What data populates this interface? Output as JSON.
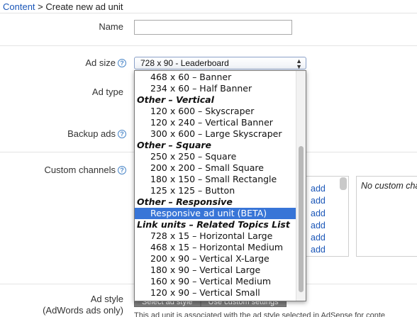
{
  "breadcrumb": {
    "link": "Content",
    "separator": " > ",
    "current": "Create new ad unit"
  },
  "form": {
    "name_label": "Name",
    "name_value": "",
    "ad_size_label": "Ad size",
    "ad_type_label": "Ad type",
    "backup_ads_label": "Backup ads",
    "custom_channels_label": "Custom channels",
    "ad_style_label_1": "Ad style",
    "ad_style_label_2": "(AdWords ads only)",
    "help_glyph": "?"
  },
  "ad_size_select": {
    "selected": "728 x 90 - Leaderboard",
    "arrows": "▲▼"
  },
  "dropdown": {
    "items": [
      {
        "type": "option",
        "label": "468 x 60 – Banner"
      },
      {
        "type": "option",
        "label": "234 x 60 – Half Banner"
      },
      {
        "type": "group",
        "label": "Other – Vertical"
      },
      {
        "type": "option",
        "label": "120 x 600 – Skyscraper"
      },
      {
        "type": "option",
        "label": "120 x 240 – Vertical Banner"
      },
      {
        "type": "option",
        "label": "300 x 600 – Large Skyscraper"
      },
      {
        "type": "group",
        "label": "Other – Square"
      },
      {
        "type": "option",
        "label": "250 x 250 – Square"
      },
      {
        "type": "option",
        "label": "200 x 200 – Small Square"
      },
      {
        "type": "option",
        "label": "180 x 150 – Small Rectangle"
      },
      {
        "type": "option",
        "label": "125 x 125 – Button"
      },
      {
        "type": "group",
        "label": "Other – Responsive"
      },
      {
        "type": "option",
        "label": "Responsive ad unit (BETA)",
        "selected": true
      },
      {
        "type": "group",
        "label": "Link units – Related Topics List"
      },
      {
        "type": "option",
        "label": "728 x 15 – Horizontal Large"
      },
      {
        "type": "option",
        "label": "468 x 15 – Horizontal Medium"
      },
      {
        "type": "option",
        "label": "200 x 90 – Vertical X-Large"
      },
      {
        "type": "option",
        "label": "180 x 90 – Vertical Large"
      },
      {
        "type": "option",
        "label": "160 x 90 – Vertical Medium"
      },
      {
        "type": "option",
        "label": "120 x 90 – Vertical Small"
      }
    ]
  },
  "channels": {
    "add_links": [
      "add",
      "add",
      "add",
      "add",
      "add",
      "add"
    ],
    "custom_placeholder": "No custom cha"
  },
  "ad_style": {
    "buttons": [
      "Select ad style",
      "Use custom settings"
    ],
    "description": "This ad unit is associated with the ad style selected in AdSense for conte"
  },
  "colors": {
    "link": "#1a56b8",
    "selection": "#3875d7"
  }
}
